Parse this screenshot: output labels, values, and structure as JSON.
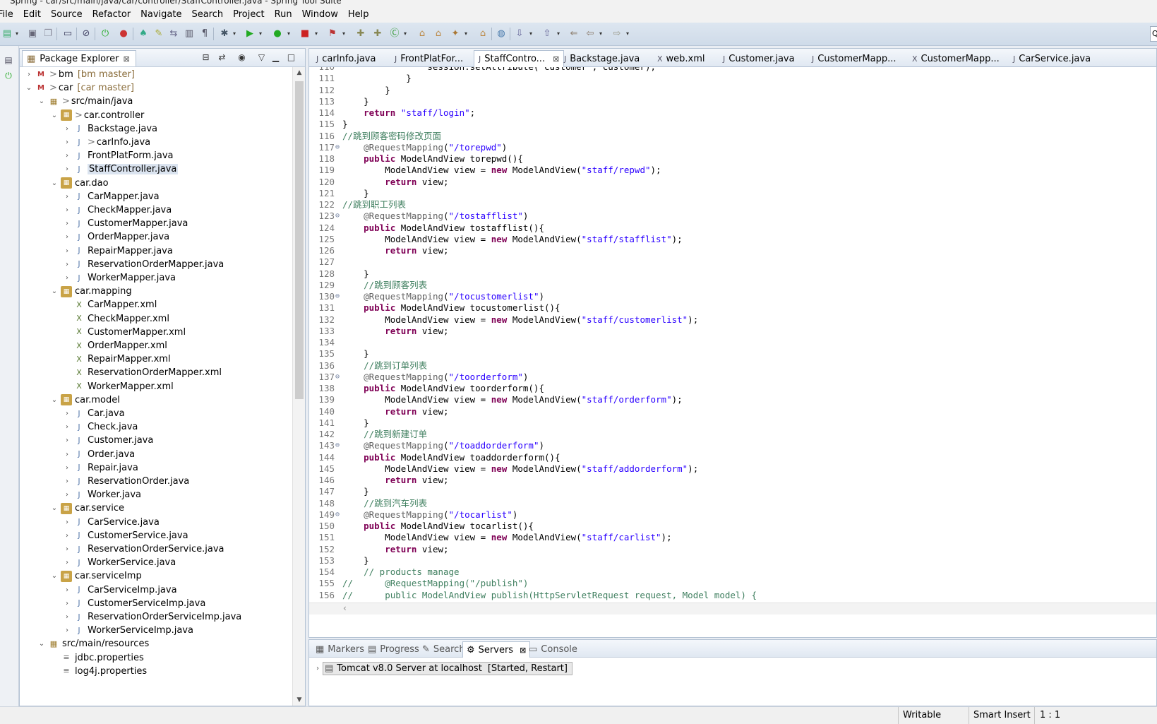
{
  "window": {
    "title": "Spring - car/src/main/java/car/controller/StaffController.java - Spring Tool Suite"
  },
  "menu": [
    "File",
    "Edit",
    "Source",
    "Refactor",
    "Navigate",
    "Search",
    "Project",
    "Run",
    "Window",
    "Help"
  ],
  "package_explorer": {
    "title": "Package Explorer",
    "items": [
      {
        "level": 0,
        "twist": "›",
        "icon": "project",
        "decor": "> ",
        "label": "bm",
        "branch": "[bm master]"
      },
      {
        "level": 0,
        "twist": "⌄",
        "icon": "project",
        "decor": "> ",
        "label": "car",
        "branch": "[car master]"
      },
      {
        "level": 1,
        "twist": "⌄",
        "icon": "srcfolder",
        "decor": "> ",
        "label": "src/main/java"
      },
      {
        "level": 2,
        "twist": "⌄",
        "icon": "package",
        "decor": "> ",
        "label": "car.controller"
      },
      {
        "level": 3,
        "twist": "›",
        "icon": "java",
        "label": "Backstage.java"
      },
      {
        "level": 3,
        "twist": "›",
        "icon": "java",
        "decor": "> ",
        "label": "carInfo.java"
      },
      {
        "level": 3,
        "twist": "›",
        "icon": "java",
        "label": "FrontPlatForm.java"
      },
      {
        "level": 3,
        "twist": "›",
        "icon": "java",
        "label": "StaffController.java",
        "selected": true
      },
      {
        "level": 2,
        "twist": "⌄",
        "icon": "package",
        "label": "car.dao"
      },
      {
        "level": 3,
        "twist": "›",
        "icon": "java",
        "label": "CarMapper.java"
      },
      {
        "level": 3,
        "twist": "›",
        "icon": "java",
        "label": "CheckMapper.java"
      },
      {
        "level": 3,
        "twist": "›",
        "icon": "java",
        "label": "CustomerMapper.java"
      },
      {
        "level": 3,
        "twist": "›",
        "icon": "java",
        "label": "OrderMapper.java"
      },
      {
        "level": 3,
        "twist": "›",
        "icon": "java",
        "label": "RepairMapper.java"
      },
      {
        "level": 3,
        "twist": "›",
        "icon": "java",
        "label": "ReservationOrderMapper.java"
      },
      {
        "level": 3,
        "twist": "›",
        "icon": "java",
        "label": "WorkerMapper.java"
      },
      {
        "level": 2,
        "twist": "⌄",
        "icon": "package",
        "label": "car.mapping"
      },
      {
        "level": 3,
        "twist": "",
        "icon": "xml",
        "label": "CarMapper.xml"
      },
      {
        "level": 3,
        "twist": "",
        "icon": "xml",
        "label": "CheckMapper.xml"
      },
      {
        "level": 3,
        "twist": "",
        "icon": "xml",
        "label": "CustomerMapper.xml"
      },
      {
        "level": 3,
        "twist": "",
        "icon": "xml",
        "label": "OrderMapper.xml"
      },
      {
        "level": 3,
        "twist": "",
        "icon": "xml",
        "label": "RepairMapper.xml"
      },
      {
        "level": 3,
        "twist": "",
        "icon": "xml",
        "label": "ReservationOrderMapper.xml"
      },
      {
        "level": 3,
        "twist": "",
        "icon": "xml",
        "label": "WorkerMapper.xml"
      },
      {
        "level": 2,
        "twist": "⌄",
        "icon": "package",
        "label": "car.model"
      },
      {
        "level": 3,
        "twist": "›",
        "icon": "java",
        "label": "Car.java"
      },
      {
        "level": 3,
        "twist": "›",
        "icon": "java",
        "label": "Check.java"
      },
      {
        "level": 3,
        "twist": "›",
        "icon": "java",
        "label": "Customer.java"
      },
      {
        "level": 3,
        "twist": "›",
        "icon": "java",
        "label": "Order.java"
      },
      {
        "level": 3,
        "twist": "›",
        "icon": "java",
        "label": "Repair.java"
      },
      {
        "level": 3,
        "twist": "›",
        "icon": "java",
        "label": "ReservationOrder.java"
      },
      {
        "level": 3,
        "twist": "›",
        "icon": "java",
        "label": "Worker.java"
      },
      {
        "level": 2,
        "twist": "⌄",
        "icon": "package",
        "label": "car.service"
      },
      {
        "level": 3,
        "twist": "›",
        "icon": "java",
        "label": "CarService.java"
      },
      {
        "level": 3,
        "twist": "›",
        "icon": "java",
        "label": "CustomerService.java"
      },
      {
        "level": 3,
        "twist": "›",
        "icon": "java",
        "label": "ReservationOrderService.java"
      },
      {
        "level": 3,
        "twist": "›",
        "icon": "java",
        "label": "WorkerService.java"
      },
      {
        "level": 2,
        "twist": "⌄",
        "icon": "package",
        "label": "car.serviceImp"
      },
      {
        "level": 3,
        "twist": "›",
        "icon": "java",
        "label": "CarServiceImp.java"
      },
      {
        "level": 3,
        "twist": "›",
        "icon": "java",
        "label": "CustomerServiceImp.java"
      },
      {
        "level": 3,
        "twist": "›",
        "icon": "java",
        "label": "ReservationOrderServiceImp.java"
      },
      {
        "level": 3,
        "twist": "›",
        "icon": "java",
        "label": "WorkerServiceImp.java"
      },
      {
        "level": 1,
        "twist": "⌄",
        "icon": "srcfolder",
        "label": "src/main/resources"
      },
      {
        "level": 2,
        "twist": "",
        "icon": "properties",
        "label": "jdbc.properties"
      },
      {
        "level": 2,
        "twist": "",
        "icon": "properties",
        "label": "log4j.properties"
      }
    ]
  },
  "editor_tabs": [
    {
      "label": "carInfo.java",
      "icon": "J"
    },
    {
      "label": "FrontPlatFor...",
      "icon": "J"
    },
    {
      "label": "StaffContro...",
      "icon": "J",
      "active": true
    },
    {
      "label": "Backstage.java",
      "icon": "J"
    },
    {
      "label": "web.xml",
      "icon": "X"
    },
    {
      "label": "Customer.java",
      "icon": "J"
    },
    {
      "label": "CustomerMapp...",
      "icon": "J"
    },
    {
      "label": "CustomerMapp...",
      "icon": "X"
    },
    {
      "label": "CarService.java",
      "icon": "J"
    }
  ],
  "code": {
    "lines": [
      {
        "n": "110",
        "t": [
          [
            "p",
            "                session.setAttribute(\"customer\", customer);"
          ]
        ]
      },
      {
        "n": "111",
        "t": [
          [
            "p",
            "            }"
          ]
        ]
      },
      {
        "n": "112",
        "t": [
          [
            "p",
            "        }"
          ]
        ]
      },
      {
        "n": "113",
        "t": [
          [
            "p",
            "    }"
          ]
        ]
      },
      {
        "n": "114",
        "t": [
          [
            "p",
            "    "
          ],
          [
            "kw",
            "return"
          ],
          [
            "p",
            " "
          ],
          [
            "str",
            "\"staff/login\""
          ],
          [
            "p",
            ";"
          ]
        ]
      },
      {
        "n": "115",
        "t": [
          [
            "p",
            "}"
          ]
        ]
      },
      {
        "n": "116",
        "t": [
          [
            "cm",
            "//跳到顾客密码修改页面"
          ]
        ]
      },
      {
        "n": "117",
        "f": "⊖",
        "t": [
          [
            "p",
            "    "
          ],
          [
            "ann",
            "@RequestMapping"
          ],
          [
            "p",
            "("
          ],
          [
            "str",
            "\"/torepwd\""
          ],
          [
            "p",
            ")"
          ]
        ]
      },
      {
        "n": "118",
        "t": [
          [
            "p",
            "    "
          ],
          [
            "kw",
            "public"
          ],
          [
            "p",
            " ModelAndView torepwd(){"
          ]
        ]
      },
      {
        "n": "119",
        "t": [
          [
            "p",
            "        ModelAndView view = "
          ],
          [
            "kw",
            "new"
          ],
          [
            "p",
            " ModelAndView("
          ],
          [
            "str",
            "\"staff/repwd\""
          ],
          [
            "p",
            ");"
          ]
        ]
      },
      {
        "n": "120",
        "t": [
          [
            "p",
            "        "
          ],
          [
            "kw",
            "return"
          ],
          [
            "p",
            " view;"
          ]
        ]
      },
      {
        "n": "121",
        "t": [
          [
            "p",
            "    }"
          ]
        ]
      },
      {
        "n": "122",
        "t": [
          [
            "cm",
            "//跳到职工列表"
          ]
        ]
      },
      {
        "n": "123",
        "f": "⊖",
        "t": [
          [
            "p",
            "    "
          ],
          [
            "ann",
            "@RequestMapping"
          ],
          [
            "p",
            "("
          ],
          [
            "str",
            "\"/tostafflist\""
          ],
          [
            "p",
            ")"
          ]
        ]
      },
      {
        "n": "124",
        "t": [
          [
            "p",
            "    "
          ],
          [
            "kw",
            "public"
          ],
          [
            "p",
            " ModelAndView tostafflist(){"
          ]
        ]
      },
      {
        "n": "125",
        "t": [
          [
            "p",
            "        ModelAndView view = "
          ],
          [
            "kw",
            "new"
          ],
          [
            "p",
            " ModelAndView("
          ],
          [
            "str",
            "\"staff/stafflist\""
          ],
          [
            "p",
            ");"
          ]
        ]
      },
      {
        "n": "126",
        "t": [
          [
            "p",
            "        "
          ],
          [
            "kw",
            "return"
          ],
          [
            "p",
            " view;"
          ]
        ]
      },
      {
        "n": "127",
        "t": [
          [
            "p",
            ""
          ]
        ]
      },
      {
        "n": "128",
        "t": [
          [
            "p",
            "    }"
          ]
        ]
      },
      {
        "n": "129",
        "t": [
          [
            "p",
            "    "
          ],
          [
            "cm",
            "//跳到顾客列表"
          ]
        ]
      },
      {
        "n": "130",
        "f": "⊖",
        "t": [
          [
            "p",
            "    "
          ],
          [
            "ann",
            "@RequestMapping"
          ],
          [
            "p",
            "("
          ],
          [
            "str",
            "\"/tocustomerlist\""
          ],
          [
            "p",
            ")"
          ]
        ]
      },
      {
        "n": "131",
        "t": [
          [
            "p",
            "    "
          ],
          [
            "kw",
            "public"
          ],
          [
            "p",
            " ModelAndView tocustomerlist(){"
          ]
        ]
      },
      {
        "n": "132",
        "t": [
          [
            "p",
            "        ModelAndView view = "
          ],
          [
            "kw",
            "new"
          ],
          [
            "p",
            " ModelAndView("
          ],
          [
            "str",
            "\"staff/customerlist\""
          ],
          [
            "p",
            ");"
          ]
        ]
      },
      {
        "n": "133",
        "t": [
          [
            "p",
            "        "
          ],
          [
            "kw",
            "return"
          ],
          [
            "p",
            " view;"
          ]
        ]
      },
      {
        "n": "134",
        "t": [
          [
            "p",
            ""
          ]
        ]
      },
      {
        "n": "135",
        "t": [
          [
            "p",
            "    }"
          ]
        ]
      },
      {
        "n": "136",
        "t": [
          [
            "p",
            "    "
          ],
          [
            "cm",
            "//跳到订单列表"
          ]
        ]
      },
      {
        "n": "137",
        "f": "⊖",
        "t": [
          [
            "p",
            "    "
          ],
          [
            "ann",
            "@RequestMapping"
          ],
          [
            "p",
            "("
          ],
          [
            "str",
            "\"/toorderform\""
          ],
          [
            "p",
            ")"
          ]
        ]
      },
      {
        "n": "138",
        "t": [
          [
            "p",
            "    "
          ],
          [
            "kw",
            "public"
          ],
          [
            "p",
            " ModelAndView toorderform(){"
          ]
        ]
      },
      {
        "n": "139",
        "t": [
          [
            "p",
            "        ModelAndView view = "
          ],
          [
            "kw",
            "new"
          ],
          [
            "p",
            " ModelAndView("
          ],
          [
            "str",
            "\"staff/orderform\""
          ],
          [
            "p",
            ");"
          ]
        ]
      },
      {
        "n": "140",
        "t": [
          [
            "p",
            "        "
          ],
          [
            "kw",
            "return"
          ],
          [
            "p",
            " view;"
          ]
        ]
      },
      {
        "n": "141",
        "t": [
          [
            "p",
            "    }"
          ]
        ]
      },
      {
        "n": "142",
        "t": [
          [
            "p",
            "    "
          ],
          [
            "cm",
            "//跳到新建订单"
          ]
        ]
      },
      {
        "n": "143",
        "f": "⊖",
        "t": [
          [
            "p",
            "    "
          ],
          [
            "ann",
            "@RequestMapping"
          ],
          [
            "p",
            "("
          ],
          [
            "str",
            "\"/toaddorderform\""
          ],
          [
            "p",
            ")"
          ]
        ]
      },
      {
        "n": "144",
        "t": [
          [
            "p",
            "    "
          ],
          [
            "kw",
            "public"
          ],
          [
            "p",
            " ModelAndView toaddorderform(){"
          ]
        ]
      },
      {
        "n": "145",
        "t": [
          [
            "p",
            "        ModelAndView view = "
          ],
          [
            "kw",
            "new"
          ],
          [
            "p",
            " ModelAndView("
          ],
          [
            "str",
            "\"staff/addorderform\""
          ],
          [
            "p",
            ");"
          ]
        ]
      },
      {
        "n": "146",
        "t": [
          [
            "p",
            "        "
          ],
          [
            "kw",
            "return"
          ],
          [
            "p",
            " view;"
          ]
        ]
      },
      {
        "n": "147",
        "t": [
          [
            "p",
            "    }"
          ]
        ]
      },
      {
        "n": "148",
        "t": [
          [
            "p",
            "    "
          ],
          [
            "cm",
            "//跳到汽车列表"
          ]
        ]
      },
      {
        "n": "149",
        "f": "⊖",
        "t": [
          [
            "p",
            "    "
          ],
          [
            "ann",
            "@RequestMapping"
          ],
          [
            "p",
            "("
          ],
          [
            "str",
            "\"/tocarlist\""
          ],
          [
            "p",
            ")"
          ]
        ]
      },
      {
        "n": "150",
        "t": [
          [
            "p",
            "    "
          ],
          [
            "kw",
            "public"
          ],
          [
            "p",
            " ModelAndView tocarlist(){"
          ]
        ]
      },
      {
        "n": "151",
        "t": [
          [
            "p",
            "        ModelAndView view = "
          ],
          [
            "kw",
            "new"
          ],
          [
            "p",
            " ModelAndView("
          ],
          [
            "str",
            "\"staff/carlist\""
          ],
          [
            "p",
            ");"
          ]
        ]
      },
      {
        "n": "152",
        "t": [
          [
            "p",
            "        "
          ],
          [
            "kw",
            "return"
          ],
          [
            "p",
            " view;"
          ]
        ]
      },
      {
        "n": "153",
        "t": [
          [
            "p",
            "    }"
          ]
        ]
      },
      {
        "n": "154",
        "t": [
          [
            "p",
            "    "
          ],
          [
            "cm",
            "// products manage"
          ]
        ]
      },
      {
        "n": "155",
        "t": [
          [
            "cm",
            "//      @RequestMapping(\"/publish\")"
          ]
        ]
      },
      {
        "n": "156",
        "t": [
          [
            "cm",
            "//      public ModelAndView publish(HttpServletRequest request, Model model) {"
          ]
        ]
      }
    ]
  },
  "bottom_tabs": [
    {
      "label": "Markers",
      "icon": "▦"
    },
    {
      "label": "Progress",
      "icon": "▤"
    },
    {
      "label": "Search",
      "icon": "✎"
    },
    {
      "label": "Servers",
      "icon": "⚙",
      "active": true
    },
    {
      "label": "Console",
      "icon": "▭"
    }
  ],
  "servers": [
    {
      "label": "Tomcat v8.0 Server at localhost",
      "state": "[Started, Restart]"
    }
  ],
  "status": {
    "writable": "Writable",
    "insert_mode": "Smart Insert",
    "position": "1 : 1"
  }
}
